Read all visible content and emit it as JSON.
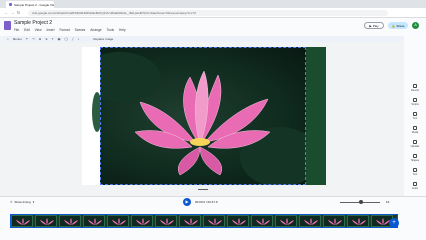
{
  "browser": {
    "tab_title": "Sample Project 2 - Google Vid",
    "url": "vids.google.com/u/0/watch/1a6F5k0t9UtRPa0kcBvKQ1VIm3DaE9GbsL_r8dLp2oIR?pli=1&authuser=0&resourcekey=0-xYZ"
  },
  "app": {
    "title": "Sample Project 2",
    "menus": [
      "File",
      "Edit",
      "View",
      "Insert",
      "Format",
      "Scenes",
      "Arrange",
      "Tools",
      "Help"
    ],
    "play_label": "Play",
    "share_label": "Share",
    "avatar_initial": "A"
  },
  "toolbar": {
    "zoom_label": "Menus",
    "replace_label": "Replace image"
  },
  "sidebar": {
    "items": [
      "Record",
      "Scripts",
      "Text",
      "Media",
      "Uploads",
      "Shapes",
      "Text",
      "Audio",
      "Templates"
    ]
  },
  "timeline": {
    "show_timing_label": "Show timing",
    "timecode": "00:00.0 / 00:37.9",
    "zoom_value": "Fit",
    "frame_count": 16
  },
  "colors": {
    "accent": "#0b57d0",
    "lotus": "#e86bb4"
  }
}
